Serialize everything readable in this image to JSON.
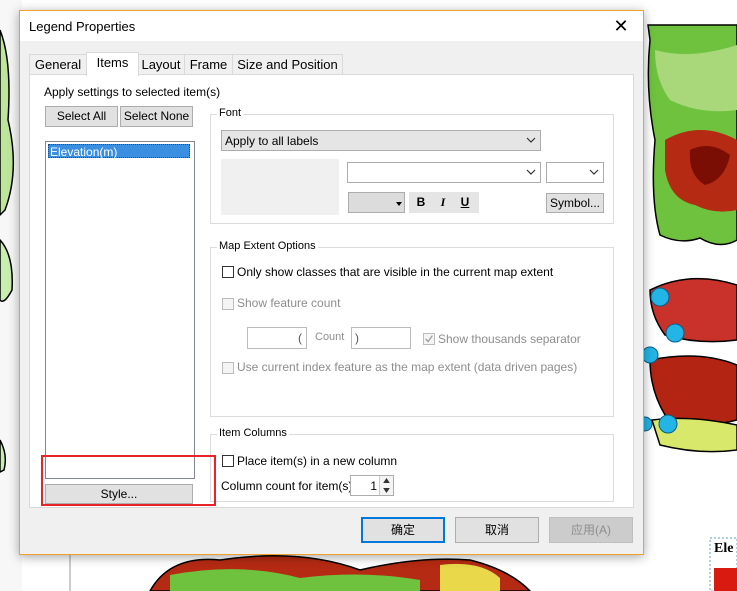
{
  "dialog": {
    "title": "Legend Properties",
    "close_glyph": "✕"
  },
  "tabs": [
    {
      "label": "General",
      "active": false
    },
    {
      "label": "Items",
      "active": true
    },
    {
      "label": "Layout",
      "active": false
    },
    {
      "label": "Frame",
      "active": false
    },
    {
      "label": "Size and Position",
      "active": false
    }
  ],
  "items_panel": {
    "apply_label": "Apply settings to selected item(s)",
    "select_all": "Select All",
    "select_none": "Select None",
    "list_items": [
      "Elevation(m)"
    ],
    "style_button": "Style..."
  },
  "font_group": {
    "title": "Font",
    "apply_combo": "Apply to all labels",
    "font_name_value": "",
    "font_size_value": "",
    "bold": "B",
    "italic": "I",
    "underline": "U",
    "symbol_button": "Symbol..."
  },
  "map_extent_group": {
    "title": "Map Extent Options",
    "only_show_visible": "Only show classes that are visible in the current map extent",
    "show_feature_count": "Show feature count",
    "paren_open": "(",
    "count_label": "Count",
    "paren_close": ")",
    "show_thousands": "Show thousands separator",
    "use_index_feature": "Use current index feature as the map extent (data driven pages)"
  },
  "item_columns_group": {
    "title": "Item Columns",
    "place_new_column": "Place item(s) in a new column",
    "column_count_label": "Column count for item(s)",
    "column_count_value": "1"
  },
  "footer": {
    "ok": "确定",
    "cancel": "取消",
    "apply": "应用(A)"
  },
  "background": {
    "legend_fragment": "Ele"
  },
  "colors": {
    "accent_blue": "#0078d7",
    "highlight_red": "#e8232a",
    "selection_blue": "#3a8fe0"
  }
}
